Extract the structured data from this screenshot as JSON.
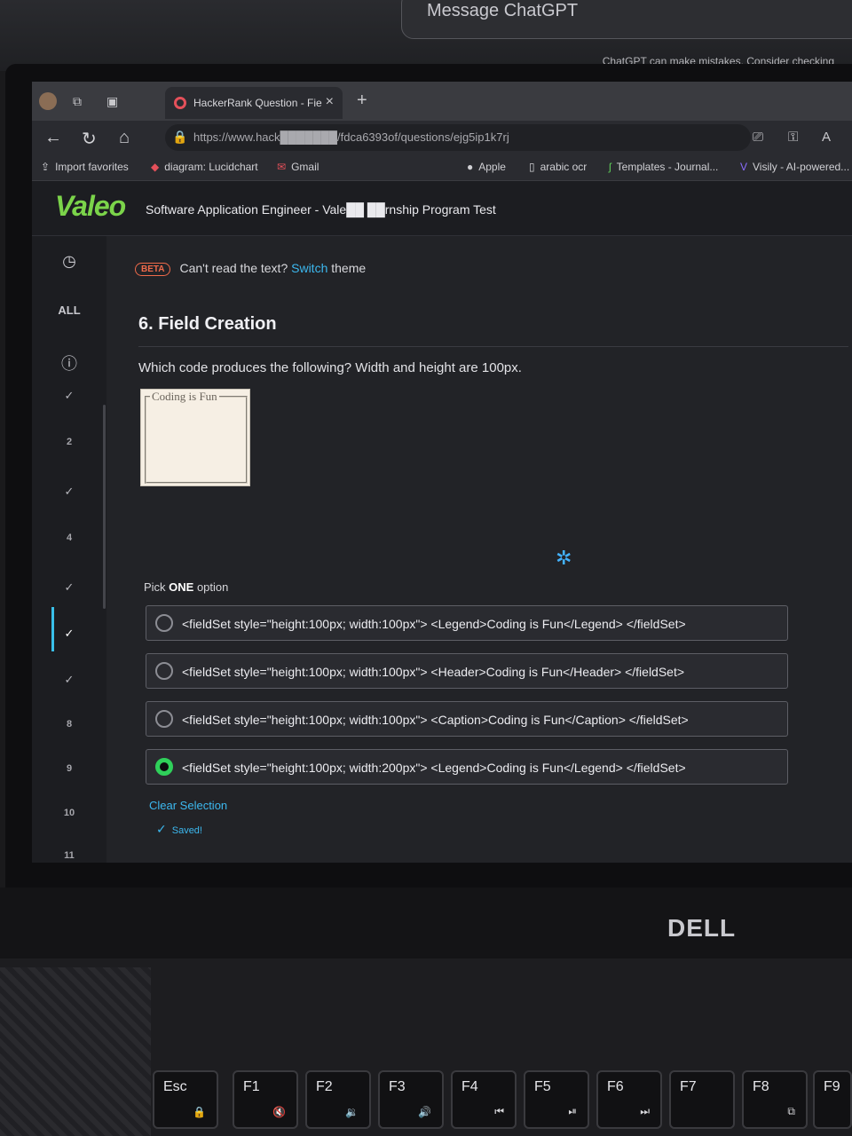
{
  "external_monitor": {
    "input_placeholder": "Message ChatGPT",
    "note": "ChatGPT can make mistakes. Consider checking"
  },
  "browser": {
    "tab": {
      "title": "HackerRank Question - Fie"
    },
    "url": "https://www.hack███████/fdca6393of/questions/ejg5ip1k7rj",
    "bookmarks": [
      {
        "label": "Import favorites"
      },
      {
        "label": "diagram: Lucidchart"
      },
      {
        "label": "Gmail"
      },
      {
        "label": "Apple"
      },
      {
        "label": "arabic ocr"
      },
      {
        "label": "Templates - Journal..."
      },
      {
        "label": "Visily - AI-powered..."
      }
    ]
  },
  "app": {
    "logo": "Valeo",
    "test_title": "Software Application Engineer - Vale██ ██rnship Program Test",
    "beta": {
      "badge": "BETA",
      "text": "Can't read the text?",
      "link": "Switch",
      "suffix": "theme"
    },
    "sidebar": {
      "all_label": "ALL",
      "items": [
        "✓",
        "2",
        "✓",
        "4",
        "✓",
        "✓",
        "✓",
        "8",
        "9",
        "10",
        "11"
      ]
    },
    "question": {
      "title": "6. Field Creation",
      "text": "Which code produces the following?  Width and height are 100px.",
      "preview_legend": "Coding is Fun",
      "pick_prefix": "Pick ",
      "pick_bold": "ONE",
      "pick_suffix": " option",
      "options": [
        {
          "text": "<fieldSet style=\"height:100px; width:100px\"> <Legend>Coding is Fun</Legend> </fieldSet>",
          "selected": false
        },
        {
          "text": "<fieldSet style=\"height:100px; width:100px\"> <Header>Coding is Fun</Header> </fieldSet>",
          "selected": false
        },
        {
          "text": "<fieldSet style=\"height:100px; width:100px\"> <Caption>Coding is Fun</Caption> </fieldSet>",
          "selected": false
        },
        {
          "text": "<fieldSet style=\"height:100px; width:200px\"> <Legend>Coding is Fun</Legend> </fieldSet>",
          "selected": true
        }
      ],
      "clear_selection": "Clear Selection",
      "saved": "Saved!"
    }
  },
  "laptop": {
    "brand": "DELL",
    "keys": [
      {
        "label": "Esc",
        "sub": "🔒"
      },
      {
        "label": "F1",
        "sub": "🔇"
      },
      {
        "label": "F2",
        "sub": "🔉"
      },
      {
        "label": "F3",
        "sub": "🔊"
      },
      {
        "label": "F4",
        "sub": "⏮"
      },
      {
        "label": "F5",
        "sub": "⏯"
      },
      {
        "label": "F6",
        "sub": "⏭"
      },
      {
        "label": "F7",
        "sub": ""
      },
      {
        "label": "F8",
        "sub": "⧉"
      },
      {
        "label": "F9",
        "sub": ""
      }
    ]
  },
  "colors": {
    "accent": "#3cb8ef",
    "selected_radio": "#2fd05a",
    "beta": "#ef6a4a",
    "logo": "#7bd44a"
  }
}
